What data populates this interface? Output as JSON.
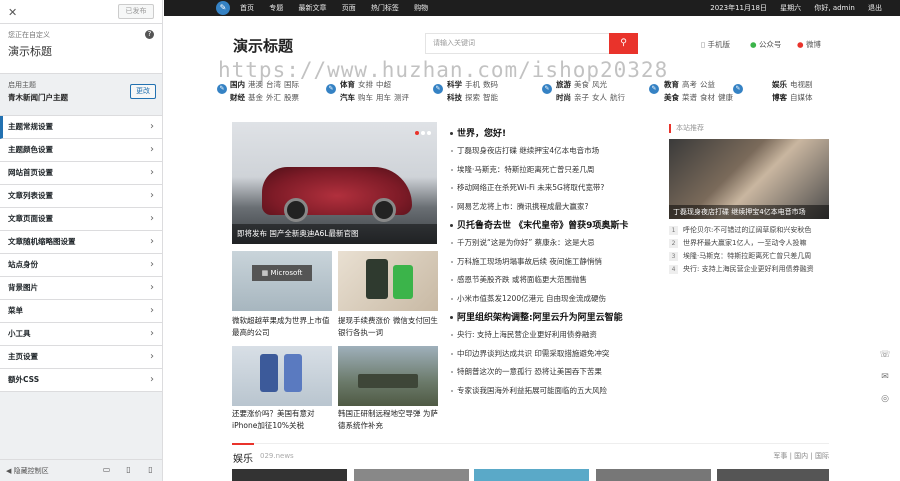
{
  "customizer": {
    "publish_label": "已发布",
    "customizing_label": "您正在自定义",
    "site_title": "演示标题",
    "active_theme_label": "启用主题",
    "theme_name": "青木新闻门户主题",
    "change_label": "更改",
    "menu": [
      "主题常规设置",
      "主题颜色设置",
      "网站首页设置",
      "文章列表设置",
      "文章页面设置",
      "文章随机缩略图设置",
      "站点身份",
      "背景图片",
      "菜单",
      "小工具",
      "主页设置",
      "额外CSS"
    ],
    "hide_controls_label": "隐藏控制区"
  },
  "topbar": {
    "nav": [
      "首页",
      "专题",
      "最新文章",
      "页面",
      "热门标签",
      "购物"
    ],
    "date": "2023年11月18日",
    "weekday": "星期六",
    "greeting": "你好, admin",
    "logout": "退出"
  },
  "header": {
    "logo": "演示标题",
    "search_placeholder": "请输入关键词",
    "links": [
      "手机版",
      "公众号",
      "微博"
    ]
  },
  "categories": [
    {
      "main": [
        "国内",
        "财经"
      ],
      "subs": [
        [
          "港澳",
          "台湾",
          "国际"
        ],
        [
          "基金",
          "外汇",
          "股票"
        ]
      ]
    },
    {
      "main": [
        "体育",
        "汽车"
      ],
      "subs": [
        [
          "女排",
          "中超"
        ],
        [
          "购车",
          "用车",
          "测评"
        ]
      ]
    },
    {
      "main": [
        "科学",
        "科技"
      ],
      "subs": [
        [
          "手机",
          "数码"
        ],
        [
          "探索",
          "智能"
        ]
      ]
    },
    {
      "main": [
        "旅游",
        "时尚"
      ],
      "subs": [
        [
          "美食",
          "风光"
        ],
        [
          "亲子",
          "女人",
          "航行"
        ]
      ]
    },
    {
      "main": [
        "教育",
        "美食"
      ],
      "subs": [
        [
          "高考",
          "公益"
        ],
        [
          "菜谱",
          "食材",
          "健康"
        ]
      ]
    },
    {
      "main": [
        "娱乐",
        "博客"
      ],
      "subs": [
        [
          "电视剧"
        ],
        [
          "自媒体"
        ]
      ]
    }
  ],
  "watermark": "https://www.huzhan.com/ishop20328",
  "featured": {
    "caption": "即将发布 国产全新奥迪A6L最新官图"
  },
  "thumbs": [
    {
      "caption": "微软超越苹果成为世界上市值最高的公司"
    },
    {
      "caption": "提现手续费涨价 微信支付回生银行各执一词"
    },
    {
      "caption": "还要涨价吗？美国有意对iPhone加征10%关税"
    },
    {
      "caption": "韩国正研制远程地空导弹 为萨德系统作补充"
    }
  ],
  "news": [
    {
      "headline": "世界，您好!",
      "items": [
        "丁磊现身夜店打碟 继续押宝4亿本电音市场",
        "埃隆·马斯克：特斯拉距离死亡曾只差几周",
        "移动网络正在杀死Wi-Fi 未来5G将取代宽带?",
        "网易艺龙将上市：腾讯携程成最大赢家?"
      ]
    },
    {
      "headline": "贝托鲁奇去世 《末代皇帝》曾获9项奥斯卡",
      "items": [
        "千万别说“这是为你好” 蔡康永：这是大忌",
        "万科施工现场坍塌事故后续 夜间施工静悄悄",
        "感恩节美股齐跌 或将面临更大范围抛售",
        "小米市值蒸发1200亿港元 自由现金流成硬伤"
      ]
    },
    {
      "headline": "阿里组织架构调整:阿里云升为阿里云智能",
      "items": [
        "央行: 支持上海民营企业更好利用债券融资",
        "中印边界谈判达成共识 印需采取措施避免冲突",
        "特朗普这次的一意孤行 恐将让美国吞下苦果",
        "专家谈我国海外利益拓展可能面临的五大风险"
      ]
    }
  ],
  "recommend": {
    "title": "本站推荐",
    "image_caption": "丁磊现身夜店打碟 继续押宝4亿本电音市场",
    "items": [
      "呼伦贝尔:不可错过的辽阔草原和兴安秋色",
      "世界杯最大赢家1亿人，一至动令人投嘛",
      "埃隆·马斯克：特斯拉距离死亡曾只差几周",
      "央行: 支持上海民营企业更好利用债券融资"
    ]
  },
  "section": {
    "name": "娱乐",
    "domain": "029.news",
    "tabs": "军事 | 国内 | 国际"
  }
}
